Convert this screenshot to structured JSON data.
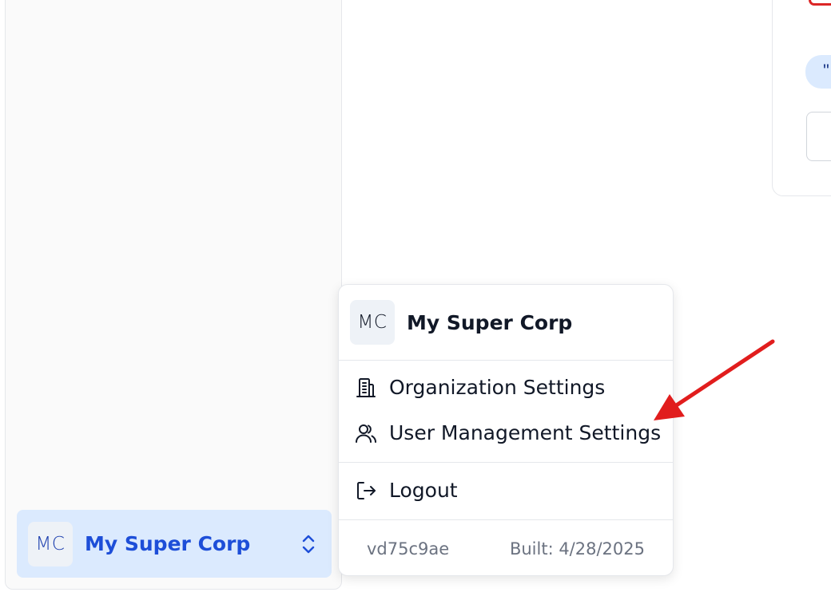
{
  "sidebar": {
    "org_switcher": {
      "initials": "MC",
      "org_name": "My Super Corp",
      "chevron_icon": "chevron-up-down-icon"
    }
  },
  "right_panel": {
    "chip_text": "\""
  },
  "menu": {
    "header": {
      "initials": "MC",
      "org_name": "My Super Corp"
    },
    "items": [
      {
        "label": "Organization Settings",
        "icon": "building-icon"
      },
      {
        "label": "User Management Settings",
        "icon": "users-icon"
      },
      {
        "label": "Logout",
        "icon": "logout-icon"
      }
    ],
    "footer": {
      "version": "vd75c9ae",
      "built": "Built: 4/28/2025"
    }
  },
  "colors": {
    "accent": "#1d4ed8",
    "highlight": "#dbeafe",
    "arrow": "#e11d1d"
  }
}
